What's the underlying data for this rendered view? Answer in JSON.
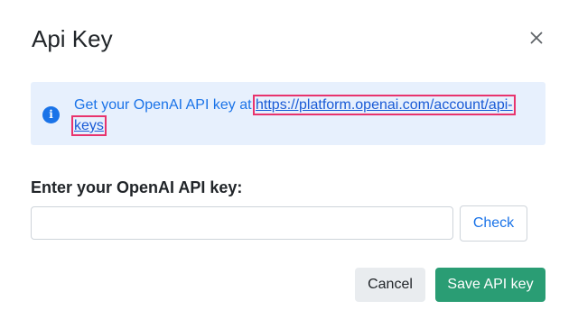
{
  "dialog": {
    "title": "Api Key",
    "close_icon": "close-icon"
  },
  "alert": {
    "icon": "info-icon",
    "icon_glyph": "i",
    "text_prefix": "Get your OpenAI API key at ",
    "link_text": "https://platform.openai.com/account/api-keys"
  },
  "form": {
    "label": "Enter your OpenAI API key:",
    "input_value": "",
    "input_placeholder": "",
    "check_label": "Check"
  },
  "footer": {
    "cancel_label": "Cancel",
    "save_label": "Save API key"
  },
  "colors": {
    "accent": "#1a73e8",
    "alert_bg": "#e7f0fd",
    "save_button": "#2a9d74",
    "highlight_outline": "#e8336d"
  }
}
